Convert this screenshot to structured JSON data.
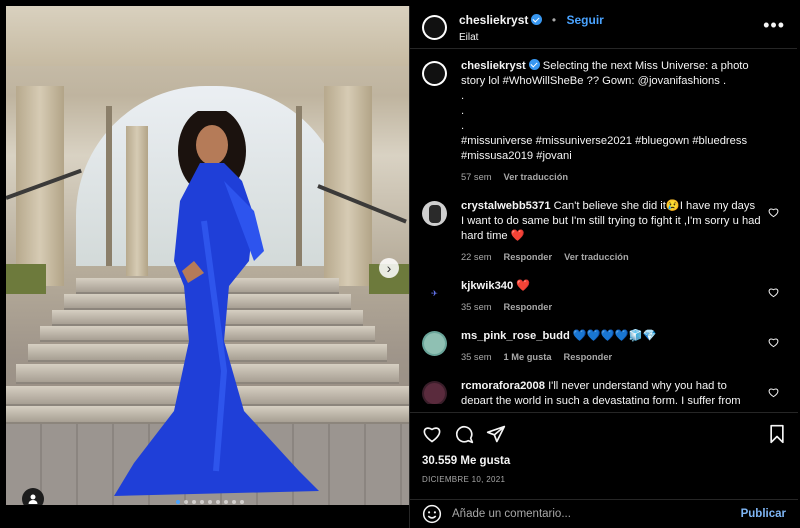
{
  "post": {
    "username": "chesliekryst",
    "follow_label": "Seguir",
    "separator": "•",
    "location": "Eilat",
    "more_label": "•••"
  },
  "caption": {
    "username": "chesliekryst",
    "text": "Selecting the next Miss Universe: a photo story lol #WhoWillSheBe ?? Gown: @jovanifashions .",
    "dot1": ".",
    "dot2": ".",
    "dot3": ".",
    "hashtags": "#missuniverse #missuniverse2021 #bluegown #bluedress #missusa2019 #jovani",
    "time": "57 sem",
    "translate": "Ver traducción"
  },
  "comments": [
    {
      "username": "crystalwebb5371",
      "text": "Can't believe she did it😢I have my days I want to do same but I'm still trying to fight it ,I'm sorry u had hard time ❤️",
      "time": "22 sem",
      "reply": "Responder",
      "translate": "Ver traducción"
    },
    {
      "username": "kjkwik340",
      "text": "❤️",
      "time": "35 sem",
      "reply": "Responder"
    },
    {
      "username": "ms_pink_rose_budd",
      "text": "💙💙💙💙🧊💎",
      "time": "35 sem",
      "likes": "1 Me gusta",
      "reply": "Responder"
    },
    {
      "username": "rcmorafora2008",
      "text": "I'll never understand why you had to depart the world in such a devastating form. I suffer from depression"
    }
  ],
  "actions": {
    "likes": "30.559 Me gusta",
    "date": "DICIEMBRE 10, 2021"
  },
  "add_comment": {
    "placeholder": "Añade un comentario...",
    "publish": "Publicar"
  },
  "colors": {
    "accent": "#4aa3ff",
    "dress": "#1f3fd8",
    "background": "#000000"
  }
}
